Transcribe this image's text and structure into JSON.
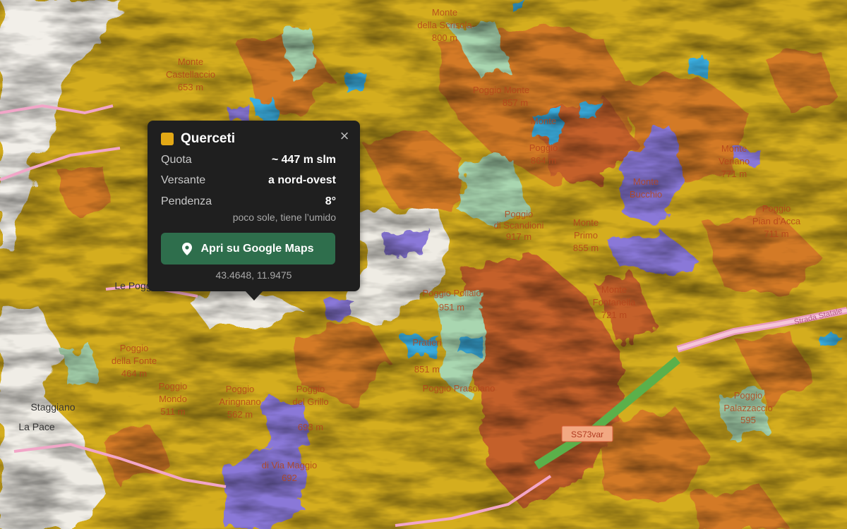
{
  "map": {
    "labels": [
      {
        "text": "Monte",
        "kind": "terrain"
      },
      {
        "text": "della Scrisola",
        "kind": "terrain"
      },
      {
        "text": "800 m",
        "kind": "terrain"
      },
      {
        "text": "Monte",
        "kind": "terrain"
      },
      {
        "text": "Castellaccio",
        "kind": "terrain"
      },
      {
        "text": "653 m",
        "kind": "terrain"
      },
      {
        "text": "Poggio Monte",
        "kind": "terrain"
      },
      {
        "text": "857 m",
        "kind": "terrain"
      },
      {
        "text": "Monte",
        "kind": "terrain"
      },
      {
        "text": "Poggio",
        "kind": "terrain"
      },
      {
        "text": "864 m",
        "kind": "terrain"
      },
      {
        "text": "Monte",
        "kind": "terrain"
      },
      {
        "text": "Veriano",
        "kind": "terrain"
      },
      {
        "text": "771 m",
        "kind": "terrain"
      },
      {
        "text": "Monte",
        "kind": "terrain"
      },
      {
        "text": "Bucchio",
        "kind": "terrain"
      },
      {
        "text": "Poggio",
        "kind": "terrain"
      },
      {
        "text": "Pian d'Acca",
        "kind": "terrain"
      },
      {
        "text": "711 m",
        "kind": "terrain"
      },
      {
        "text": "Poggio",
        "kind": "terrain"
      },
      {
        "text": "di Scandioni",
        "kind": "terrain"
      },
      {
        "text": "917 m",
        "kind": "terrain"
      },
      {
        "text": "Monte",
        "kind": "terrain"
      },
      {
        "text": "Primo",
        "kind": "terrain"
      },
      {
        "text": "855 m",
        "kind": "terrain"
      },
      {
        "text": "Poggio Pollaio",
        "kind": "terrain"
      },
      {
        "text": "951 m",
        "kind": "terrain"
      },
      {
        "text": "Monte",
        "kind": "terrain"
      },
      {
        "text": "Fontanella",
        "kind": "terrain"
      },
      {
        "text": "721 m",
        "kind": "terrain"
      },
      {
        "text": "Poggio",
        "kind": "terrain"
      },
      {
        "text": "della Fonte",
        "kind": "terrain"
      },
      {
        "text": "464 m",
        "kind": "terrain"
      },
      {
        "text": "Poggio",
        "kind": "terrain"
      },
      {
        "text": "Mondo",
        "kind": "terrain"
      },
      {
        "text": "511 m",
        "kind": "terrain"
      },
      {
        "text": "Poggio",
        "kind": "terrain"
      },
      {
        "text": "Aringnano",
        "kind": "terrain"
      },
      {
        "text": "562 m",
        "kind": "terrain"
      },
      {
        "text": "Poggio",
        "kind": "terrain"
      },
      {
        "text": "del Grillo",
        "kind": "terrain"
      },
      {
        "text": "693 m",
        "kind": "terrain"
      },
      {
        "text": "Pratieri",
        "kind": "terrain"
      },
      {
        "text": "851 m",
        "kind": "terrain"
      },
      {
        "text": "Poggio Prasolano",
        "kind": "terrain"
      },
      {
        "text": "di Via Maggio",
        "kind": "terrain"
      },
      {
        "text": "692",
        "kind": "terrain"
      },
      {
        "text": "Poggio",
        "kind": "terrain"
      },
      {
        "text": "Palazzaccio",
        "kind": "terrain"
      },
      {
        "text": "595",
        "kind": "terrain"
      },
      {
        "text": "Le Poggi",
        "kind": "place"
      },
      {
        "text": "Staggiano",
        "kind": "place"
      },
      {
        "text": "La Pace",
        "kind": "place"
      },
      {
        "text": "Strada Statale",
        "kind": "road"
      }
    ],
    "road_shield": "SS73var",
    "legend_colors": {
      "querceti": "#d4ad1e",
      "castagneti": "#d37a28",
      "faggete": "#c8662a",
      "boschi_misti": "#a9d6b0",
      "conifere": "#8a78d8",
      "acqua": "#3aaee0",
      "urbano": "#f2efe9"
    }
  },
  "popup": {
    "title": "Querceti",
    "swatch_color": "#e2a815",
    "close_icon": "close-icon",
    "rows": [
      {
        "key": "Quota",
        "value": "~ 447 m slm"
      },
      {
        "key": "Versante",
        "value": "a nord-ovest"
      },
      {
        "key": "Pendenza",
        "value": "8°"
      }
    ],
    "note": "poco sole, tiene l’umido",
    "button_label": "Apri su Google Maps",
    "button_icon": "map-pin-icon",
    "coords": "43.4648, 11.9475"
  }
}
